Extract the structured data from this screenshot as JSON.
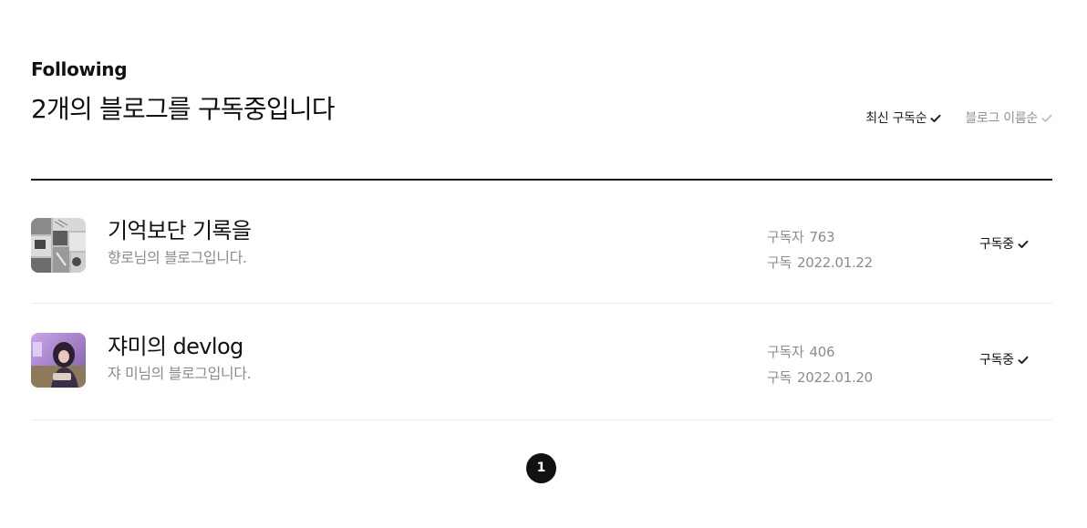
{
  "header": {
    "section_title": "Following",
    "subtitle": "2개의 블로그를 구독중입니다"
  },
  "sort": {
    "options": [
      {
        "label": "최신 구독순",
        "active": true,
        "icon": "check-icon"
      },
      {
        "label": "블로그 이름순",
        "active": false,
        "icon": "check-icon"
      }
    ]
  },
  "blogs": [
    {
      "name": "기억보단 기록을",
      "description": "향로님의 블로그입니다.",
      "subscribers_label": "구독자",
      "subscribers": "763",
      "subscribed_label": "구독",
      "subscribed_date": "2022.01.22",
      "state_label": "구독중",
      "state_icon": "check-icon",
      "thumbnail": "manga-collage-thumbnail"
    },
    {
      "name": "쟈미의 devlog",
      "description": "쟈 미님의 블로그입니다.",
      "subscribers_label": "구독자",
      "subscribers": "406",
      "subscribed_label": "구독",
      "subscribed_date": "2022.01.20",
      "state_label": "구독중",
      "state_icon": "check-icon",
      "thumbnail": "person-photo-thumbnail"
    }
  ],
  "pagination": {
    "pages": [
      "1"
    ],
    "current": "1"
  },
  "colors": {
    "text_primary": "#111111",
    "text_secondary": "#8c8c8c",
    "sort_inactive": "#909090",
    "divider": "#ececec",
    "page_active_bg": "#111111"
  }
}
